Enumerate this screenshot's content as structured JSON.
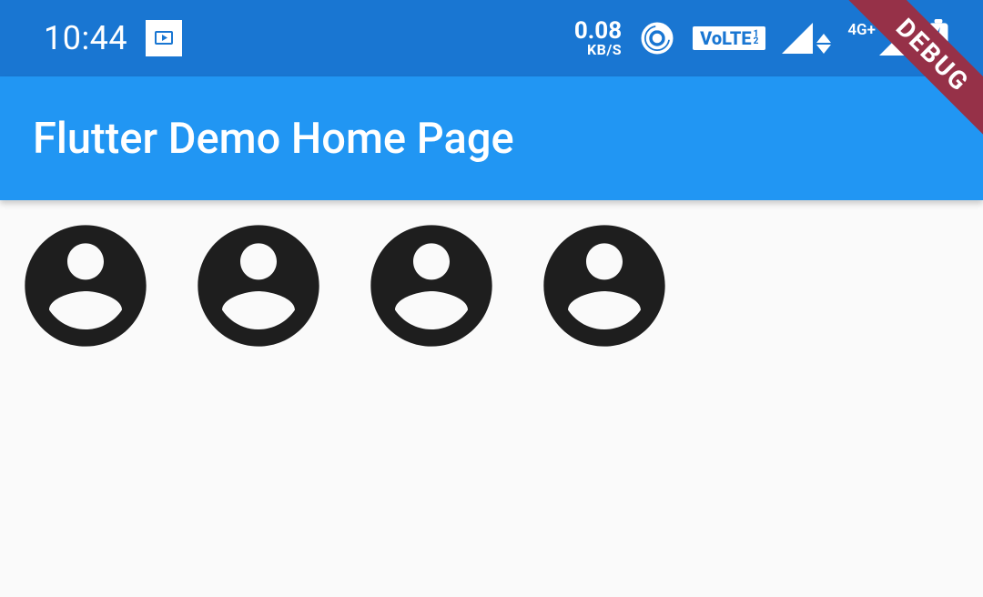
{
  "status_bar": {
    "time": "10:44",
    "net_speed_value": "0.08",
    "net_speed_unit": "KB/S",
    "volte_label": "VoLTE",
    "volte_sub1": "1",
    "volte_sub2": "2",
    "signal2_label": "4G+"
  },
  "app_bar": {
    "title": "Flutter Demo Home Page"
  },
  "debug_banner": "DEBUG",
  "avatars": [
    {
      "name": "avatar-1"
    },
    {
      "name": "avatar-2"
    },
    {
      "name": "avatar-3"
    },
    {
      "name": "avatar-4"
    }
  ]
}
